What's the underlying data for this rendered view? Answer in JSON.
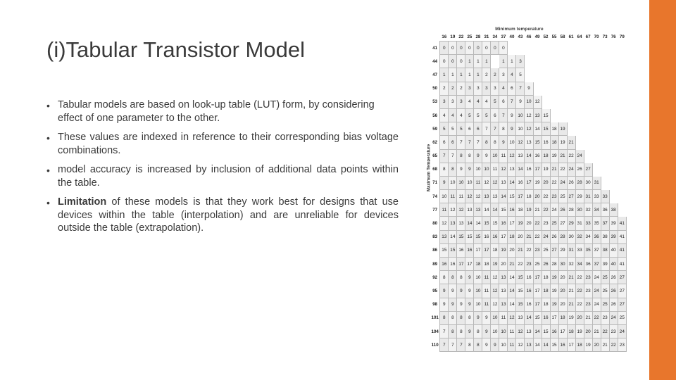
{
  "slide": {
    "title": "(i)Tabular Transistor Model",
    "bullet_marker": "•",
    "bullets": [
      {
        "text": "Tabular models are based on look-up table (LUT) form, by considering effect of one parameter to the other.",
        "justify": false
      },
      {
        "text": "These values are indexed in reference to their corresponding bias voltage combinations.",
        "justify": true
      },
      {
        "text": "model accuracy is increased by inclusion of additional data points within the table.",
        "justify": true
      },
      {
        "text": "Limitation of these models is that they work best for designs that use devices within the table (interpolation) and are unreliable for devices outside the table (extrapolation).",
        "justify": true,
        "bold_lead": "Limitation"
      }
    ],
    "accent_color": "#e8762c",
    "text_color": "#3a3a3a"
  },
  "figure": {
    "name": "lookup-table-figure",
    "top_label": "Minimum temperature",
    "left_label": "Maximum Temperature",
    "col_headers": [
      "16",
      "19",
      "22",
      "25",
      "28",
      "31",
      "34",
      "37",
      "40",
      "43",
      "46",
      "49",
      "52",
      "55",
      "58",
      "61",
      "64",
      "67",
      "70",
      "73",
      "76",
      "79"
    ],
    "row_headers": [
      "41",
      "44",
      "47",
      "50",
      "53",
      "56",
      "59",
      "62",
      "65",
      "68",
      "71",
      "74",
      "77",
      "80",
      "83",
      "86",
      "89",
      "92",
      "95",
      "98",
      "101",
      "104",
      "110"
    ],
    "rows": [
      [
        "0",
        "0",
        "0",
        "0",
        "0",
        "0",
        "0",
        "0",
        "",
        "",
        "",
        "",
        "",
        "",
        "",
        "",
        "",
        "",
        "",
        "",
        "",
        ""
      ],
      [
        "0",
        "0",
        "0",
        "1",
        "1",
        "1",
        "",
        "1",
        "1",
        "3",
        "",
        "",
        "",
        "",
        "",
        "",
        "",
        "",
        "",
        "",
        "",
        ""
      ],
      [
        "1",
        "1",
        "1",
        "1",
        "1",
        "2",
        "2",
        "3",
        "4",
        "5",
        "",
        "",
        "",
        "",
        "",
        "",
        "",
        "",
        "",
        "",
        "",
        ""
      ],
      [
        "2",
        "2",
        "2",
        "3",
        "3",
        "3",
        "3",
        "4",
        "6",
        "7",
        "9",
        "",
        "",
        "",
        "",
        "",
        "",
        "",
        "",
        "",
        "",
        ""
      ],
      [
        "3",
        "3",
        "3",
        "4",
        "4",
        "4",
        "5",
        "6",
        "7",
        "9",
        "10",
        "12",
        "",
        "",
        "",
        "",
        "",
        "",
        "",
        "",
        "",
        ""
      ],
      [
        "4",
        "4",
        "4",
        "5",
        "5",
        "5",
        "6",
        "7",
        "9",
        "10",
        "12",
        "13",
        "15",
        "",
        "",
        "",
        "",
        "",
        "",
        "",
        "",
        ""
      ],
      [
        "5",
        "5",
        "5",
        "6",
        "6",
        "7",
        "7",
        "8",
        "9",
        "10",
        "12",
        "14",
        "15",
        "18",
        "19",
        "",
        "",
        "",
        "",
        "",
        "",
        ""
      ],
      [
        "6",
        "6",
        "7",
        "7",
        "7",
        "8",
        "8",
        "9",
        "10",
        "12",
        "13",
        "15",
        "16",
        "18",
        "19",
        "21",
        "",
        "",
        "",
        "",
        "",
        ""
      ],
      [
        "7",
        "7",
        "8",
        "8",
        "9",
        "9",
        "10",
        "11",
        "12",
        "13",
        "14",
        "16",
        "18",
        "19",
        "21",
        "22",
        "24",
        "",
        "",
        "",
        "",
        ""
      ],
      [
        "8",
        "8",
        "9",
        "9",
        "10",
        "10",
        "11",
        "12",
        "13",
        "14",
        "16",
        "17",
        "19",
        "21",
        "22",
        "24",
        "26",
        "27",
        "",
        "",
        "",
        ""
      ],
      [
        "9",
        "10",
        "10",
        "10",
        "11",
        "12",
        "12",
        "13",
        "14",
        "16",
        "17",
        "19",
        "20",
        "22",
        "24",
        "26",
        "28",
        "30",
        "31",
        "",
        "",
        ""
      ],
      [
        "10",
        "11",
        "11",
        "12",
        "12",
        "13",
        "13",
        "14",
        "15",
        "17",
        "18",
        "20",
        "22",
        "23",
        "25",
        "27",
        "29",
        "31",
        "33",
        "33",
        "",
        ""
      ],
      [
        "11",
        "12",
        "12",
        "13",
        "13",
        "14",
        "14",
        "15",
        "16",
        "18",
        "19",
        "21",
        "22",
        "24",
        "26",
        "28",
        "30",
        "32",
        "34",
        "36",
        "38",
        ""
      ],
      [
        "12",
        "13",
        "13",
        "14",
        "14",
        "15",
        "15",
        "16",
        "17",
        "19",
        "20",
        "22",
        "23",
        "25",
        "27",
        "29",
        "31",
        "33",
        "35",
        "37",
        "39",
        "41"
      ],
      [
        "13",
        "14",
        "15",
        "15",
        "15",
        "16",
        "16",
        "17",
        "18",
        "20",
        "21",
        "22",
        "24",
        "26",
        "28",
        "30",
        "32",
        "34",
        "36",
        "38",
        "39",
        "41"
      ],
      [
        "15",
        "15",
        "16",
        "16",
        "17",
        "17",
        "18",
        "19",
        "20",
        "21",
        "22",
        "23",
        "25",
        "27",
        "29",
        "31",
        "33",
        "35",
        "37",
        "38",
        "40",
        "41"
      ],
      [
        "16",
        "16",
        "17",
        "17",
        "18",
        "18",
        "19",
        "20",
        "21",
        "22",
        "23",
        "25",
        "26",
        "28",
        "30",
        "32",
        "34",
        "36",
        "37",
        "39",
        "40",
        "41"
      ],
      [
        "8",
        "8",
        "8",
        "9",
        "10",
        "11",
        "12",
        "13",
        "14",
        "15",
        "16",
        "17",
        "18",
        "19",
        "20",
        "21",
        "22",
        "23",
        "24",
        "25",
        "26",
        "27"
      ],
      [
        "9",
        "9",
        "9",
        "9",
        "10",
        "11",
        "12",
        "13",
        "14",
        "15",
        "16",
        "17",
        "18",
        "19",
        "20",
        "21",
        "22",
        "23",
        "24",
        "25",
        "26",
        "27"
      ],
      [
        "9",
        "9",
        "9",
        "9",
        "10",
        "11",
        "12",
        "13",
        "14",
        "15",
        "16",
        "17",
        "18",
        "19",
        "20",
        "21",
        "22",
        "23",
        "24",
        "25",
        "26",
        "27"
      ],
      [
        "8",
        "8",
        "8",
        "8",
        "9",
        "9",
        "10",
        "11",
        "12",
        "13",
        "14",
        "15",
        "16",
        "17",
        "18",
        "19",
        "20",
        "21",
        "22",
        "23",
        "24",
        "25"
      ],
      [
        "7",
        "8",
        "8",
        "9",
        "8",
        "9",
        "10",
        "10",
        "11",
        "12",
        "13",
        "14",
        "15",
        "16",
        "17",
        "18",
        "19",
        "20",
        "21",
        "22",
        "23",
        "24"
      ],
      [
        "7",
        "7",
        "7",
        "8",
        "8",
        "9",
        "9",
        "10",
        "11",
        "12",
        "13",
        "14",
        "14",
        "15",
        "16",
        "17",
        "18",
        "19",
        "20",
        "21",
        "22",
        "23"
      ]
    ]
  }
}
